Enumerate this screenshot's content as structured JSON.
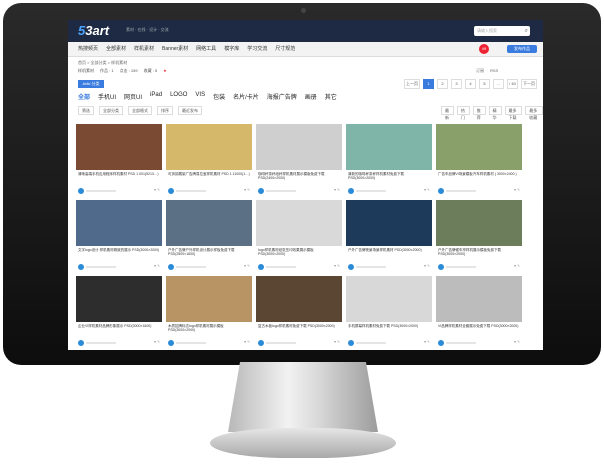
{
  "topbar": {
    "logo_prefix": "5",
    "logo_text": "3art",
    "slogan": "素材 · 在线 · 设计 · 交流",
    "search_placeholder": "请输入搜索"
  },
  "nav": {
    "items": [
      "热搜频页",
      "全部素材",
      "样机素材",
      "Banner素材",
      "网络工具",
      "模字库",
      "学习交流",
      "尺寸规范"
    ],
    "badge": "49",
    "button": "发布作品"
  },
  "breadcrumb": "首页 > 全部分类 > 样机素材",
  "meta": {
    "a": "样机素材",
    "b": "作品 : 1",
    "c": "点击 : 159",
    "d": "收藏 : 5"
  },
  "right_links": [
    "订阅",
    "RSS"
  ],
  "category_tag": "Artki 分类",
  "pager": [
    "上一页",
    "1",
    "2",
    "3",
    "4",
    "5",
    "...",
    "/ 40",
    "下一页"
  ],
  "categories": [
    "全部",
    "手机UI",
    "网页UI",
    "iPad",
    "LOGO",
    "VIS",
    "包装",
    "名片/卡片",
    "海报广告牌",
    "画册",
    "其它"
  ],
  "filters": [
    "筛选",
    "全部分类",
    "全部格式",
    "排序",
    "最近发布"
  ],
  "sorts": [
    "最新",
    "热门",
    "推荐",
    "精华",
    "最多下载",
    "最多收藏"
  ],
  "cards": [
    {
      "caption": "清晰高端手机应用程序样机素材 PSD 1 001(5213…)",
      "color": "#7b4a33"
    },
    {
      "caption": "可拆卸展架广告牌易拉宝样机素材 PSD 1 11000(1…)",
      "color": "#d6b86a"
    },
    {
      "caption": "咖啡杯茶杯纸杯样机素材展示模版免费下载PSD(2400×2000)",
      "color": "#cfcfcf"
    },
    {
      "caption": "清新的咖啡杯茶杯样机素材免费下载PSD(3000×2000)",
      "color": "#7fb5a8"
    },
    {
      "caption": "广告车品牌VI场景模板汽车样机素材 ( 3000×2400 )",
      "color": "#8aa06a"
    },
    {
      "caption": "文字logo设计 样机素材精致的展示 PSD(3000×2000)",
      "color": "#4f6a8a"
    },
    {
      "caption": "户外广告牌户外样机设计展示样板免费下载PSD(2500×1600)",
      "color": "#5b6f85"
    },
    {
      "caption": "logo样机素材纸张压印效果展示模板PSD(3000×2000)",
      "color": "#d9d9d9"
    },
    {
      "caption": "户外广告牌夜景场景样机素材 PSD(3000×2000)",
      "color": "#1e3a5a"
    },
    {
      "caption": "户外广告牌候车亭样机展示模板免费下载PSD(3000×2000)",
      "color": "#6b7d5a"
    },
    {
      "caption": "企业VI样机素材品牌形象展示 PSD(3000×1600)",
      "color": "#2d2d2d"
    },
    {
      "caption": "木质招牌标志logo样机素材展示模板 PSD(3000×2000)",
      "color": "#b89465"
    },
    {
      "caption": "复古木板logo样机素材免费下载 PSD(3000×2000)",
      "color": "#5a4632"
    },
    {
      "caption": "手机屏幕样机素材免费下载 PSD(3000×2000)",
      "color": "#d8d8d8"
    },
    {
      "caption": "VI品牌样机素材全套展示免费下载 PSD(3000×2000)",
      "color": "#bcbcbc"
    }
  ]
}
